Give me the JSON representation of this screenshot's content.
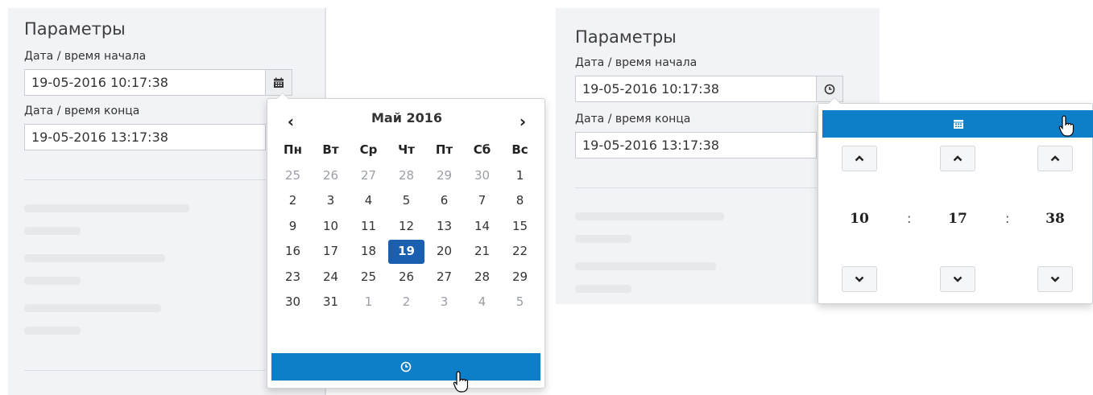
{
  "left": {
    "title": "Параметры",
    "start_label": "Дата / время начала",
    "start_value": "19-05-2016 10:17:38",
    "end_label": "Дата / время конца",
    "end_value": "19-05-2016 13:17:38",
    "addon_icon": "calendar-icon"
  },
  "calendar": {
    "month_title": "Май 2016",
    "prev": "‹",
    "next": "›",
    "weekdays": [
      "Пн",
      "Вт",
      "Ср",
      "Чт",
      "Пт",
      "Сб",
      "Вс"
    ],
    "weeks": [
      [
        "25",
        "26",
        "27",
        "28",
        "29",
        "30",
        "1"
      ],
      [
        "2",
        "3",
        "4",
        "5",
        "6",
        "7",
        "8"
      ],
      [
        "9",
        "10",
        "11",
        "12",
        "13",
        "14",
        "15"
      ],
      [
        "16",
        "17",
        "18",
        "19",
        "20",
        "21",
        "22"
      ],
      [
        "23",
        "24",
        "25",
        "26",
        "27",
        "28",
        "29"
      ],
      [
        "30",
        "31",
        "1",
        "2",
        "3",
        "4",
        "5"
      ]
    ],
    "selected_day": "19",
    "toggle_icon": "clock-icon",
    "accent": "#0d7fc8",
    "selected_color": "#1a5fb0"
  },
  "right": {
    "title": "Параметры",
    "start_label": "Дата / время начала",
    "start_value": "19-05-2016 10:17:38",
    "end_label": "Дата / время конца",
    "end_value": "19-05-2016 13:17:38",
    "addon_icon": "clock-icon"
  },
  "time": {
    "hours": "10",
    "minutes": "17",
    "seconds": "38",
    "separator": ":",
    "toggle_icon": "calendar-icon"
  }
}
